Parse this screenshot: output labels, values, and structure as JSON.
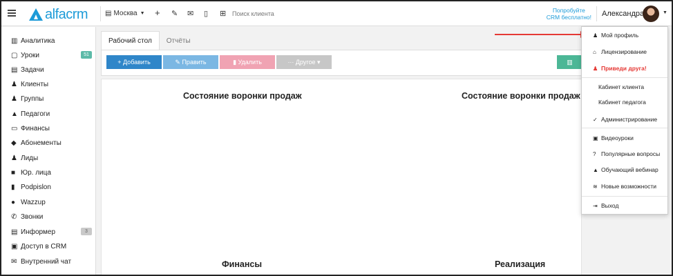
{
  "app": {
    "logo_text": "alfacrm",
    "brand_color": "#1d9bd8"
  },
  "topbar": {
    "branch_label": "Москва",
    "search_placeholder": "Поиск клиента",
    "promo_line1": "Попробуйте",
    "promo_line2": "CRM бесплатно!",
    "user_name": "Александра"
  },
  "sidebar": {
    "items": [
      {
        "icon": "analytics-icon",
        "glyph": "▥",
        "label": "Аналитика"
      },
      {
        "icon": "calendar-icon",
        "glyph": "▢",
        "label": "Уроки",
        "badge": "51"
      },
      {
        "icon": "tasks-icon",
        "glyph": "▤",
        "label": "Задачи"
      },
      {
        "icon": "user-icon",
        "glyph": "♟",
        "label": "Клиенты"
      },
      {
        "icon": "group-icon",
        "glyph": "♟",
        "label": "Группы"
      },
      {
        "icon": "graduation-cap-icon",
        "glyph": "▲",
        "label": "Педагоги"
      },
      {
        "icon": "money-icon",
        "glyph": "▭",
        "label": "Финансы"
      },
      {
        "icon": "tag-icon",
        "glyph": "◆",
        "label": "Абонементы"
      },
      {
        "icon": "user-plus-icon",
        "glyph": "♟",
        "label": "Лиды"
      },
      {
        "icon": "briefcase-icon",
        "glyph": "■",
        "label": "Юр. лица"
      },
      {
        "icon": "file-icon",
        "glyph": "▮",
        "label": "Podpislon"
      },
      {
        "icon": "whatsapp-icon",
        "glyph": "●",
        "label": "Wazzup"
      },
      {
        "icon": "phone-icon",
        "glyph": "✆",
        "label": "Звонки"
      },
      {
        "icon": "list-icon",
        "glyph": "▤",
        "label": "Информер",
        "badge": "3"
      },
      {
        "icon": "lock-icon",
        "glyph": "▣",
        "label": "Доступ в CRM"
      },
      {
        "icon": "mail-icon",
        "glyph": "✉",
        "label": "Внутренний чат"
      }
    ]
  },
  "tabs": [
    {
      "label": "Рабочий стол",
      "active": true
    },
    {
      "label": "Отчёты",
      "active": false
    }
  ],
  "toolbar": {
    "add_label": "+ Добавить",
    "edit_label": "✎ Править",
    "delete_label": "▮ Удалить",
    "other_label": "··· Другое ▾",
    "green_label": "▥"
  },
  "dashboard": {
    "title_funnel_left": "Состояние воронки продаж",
    "title_funnel_right": "Состояние воронки продаж",
    "title_finance": "Финансы",
    "title_sales": "Реализация"
  },
  "dropdown": {
    "items": [
      {
        "icon": "user-icon",
        "glyph": "♟",
        "label": "Мой профиль"
      },
      {
        "icon": "license-icon",
        "glyph": "⌂",
        "label": "Лицензирование"
      },
      {
        "icon": "invite-friend-icon",
        "glyph": "♟",
        "label": "Приведи друга!"
      },
      {
        "label": "Кабинет клиента"
      },
      {
        "label": "Кабинет педагога"
      },
      {
        "icon": "check-icon",
        "glyph": "✓",
        "label": "Администрирование"
      },
      {
        "icon": "video-icon",
        "glyph": "▣",
        "label": "Видеоуроки"
      },
      {
        "icon": "question-icon",
        "glyph": "?",
        "label": "Популярные вопросы"
      },
      {
        "icon": "webinar-icon",
        "glyph": "▲",
        "label": "Обучающий вебинар"
      },
      {
        "icon": "wifi-icon",
        "glyph": "≋",
        "label": "Новые возможности"
      },
      {
        "icon": "logout-icon",
        "glyph": "⇥",
        "label": "Выход"
      }
    ]
  },
  "colors": {
    "add": "#2f86c9",
    "edit": "#7bb7e3",
    "delete": "#f0a3b3",
    "other": "#c7c7c7",
    "accent_red": "#e53935"
  }
}
